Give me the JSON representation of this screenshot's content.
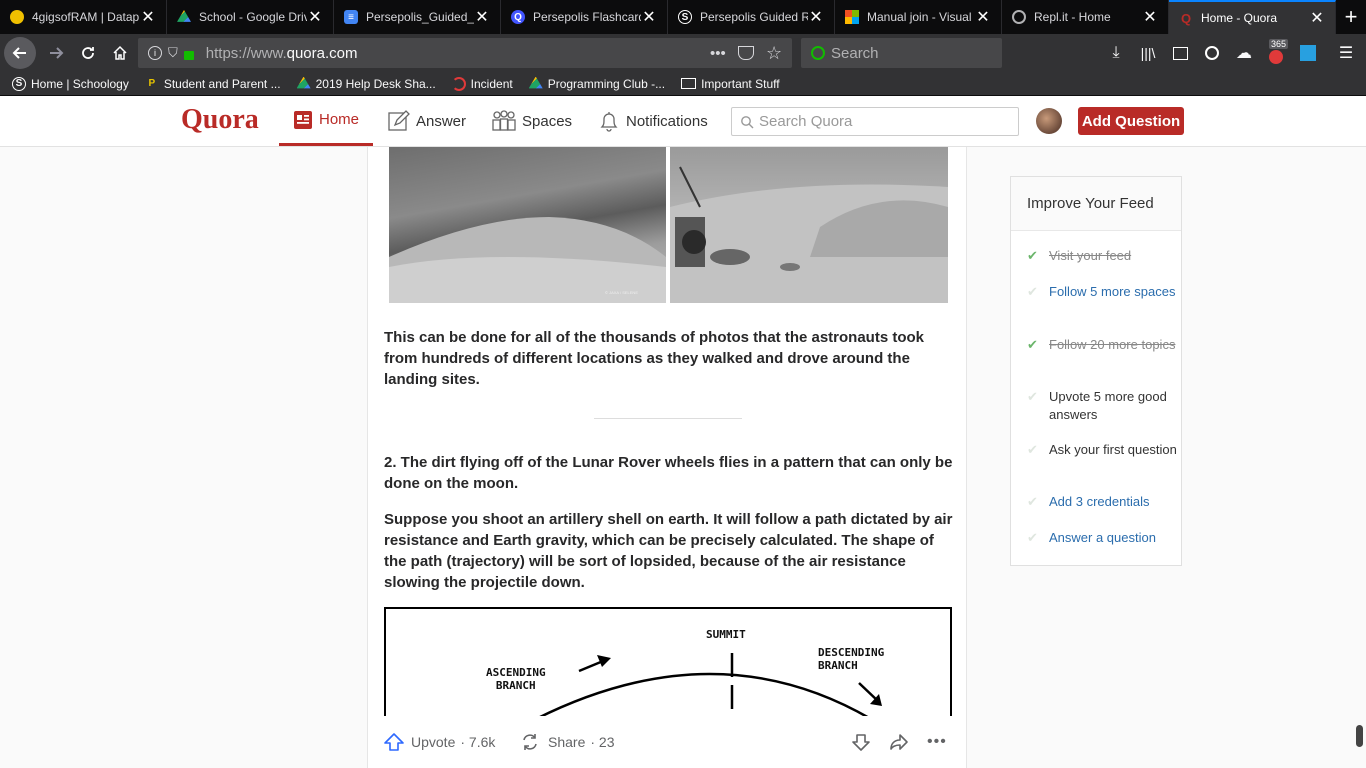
{
  "browser": {
    "tabs": [
      {
        "title": "4gigsofRAM | Datap",
        "favicon_color": "#f0c000"
      },
      {
        "title": "School - Google Driv",
        "favicon_color": "#1fa463"
      },
      {
        "title": "Persepolis_Guided_R",
        "favicon_color": "#4285f4"
      },
      {
        "title": "Persepolis Flashcard",
        "favicon_color": "#4255ff"
      },
      {
        "title": "Persepolis Guided R",
        "favicon_color": "#2a2a2e"
      },
      {
        "title": "Manual join - Visual",
        "favicon_color": "#f25022"
      },
      {
        "title": "Repl.it - Home",
        "favicon_color": "#667881"
      },
      {
        "title": "Home - Quora",
        "favicon_color": "#b92b27"
      }
    ],
    "url_prefix": "https://www.",
    "url_domain": "quora.com",
    "search_placeholder": "Search",
    "badge_count": "365",
    "bookmarks": [
      {
        "label": "Home | Schoology"
      },
      {
        "label": "Student and Parent ..."
      },
      {
        "label": "2019 Help Desk Sha..."
      },
      {
        "label": "Incident"
      },
      {
        "label": "Programming Club -..."
      },
      {
        "label": "Important Stuff"
      }
    ]
  },
  "quora": {
    "logo": "Quora",
    "nav": {
      "home": "Home",
      "answer": "Answer",
      "spaces": "Spaces",
      "notifications": "Notifications"
    },
    "search_placeholder": "Search Quora",
    "add_question": "Add Question"
  },
  "answer": {
    "para1": "This can be done for all of the thousands of photos that the astronauts took from hundreds of different locations as they walked and drove around the landing sites.",
    "heading2": "2. The dirt flying off of the Lunar Rover wheels flies in a pattern that can only be done on the moon.",
    "para2": "Suppose you shoot an artillery shell on earth. It will follow a path dictated by air resistance and Earth gravity, which can be precisely calculated. The shape of the path (trajectory) will be sort of lopsided, because of the air resistance slowing the projectile down.",
    "diagram": {
      "summit": "SUMMIT",
      "ascending": "ASCENDING\nBRANCH",
      "descending": "DESCENDING\nBRANCH"
    },
    "photo_credit": "© JAXA / SELENE",
    "actions": {
      "upvote": "Upvote",
      "upvote_count": "· 7.6k",
      "share": "Share",
      "share_count": "· 23"
    }
  },
  "feed": {
    "title": "Improve Your Feed",
    "items": [
      {
        "label": "Visit your feed",
        "state": "done"
      },
      {
        "label": "Follow 5 more spaces",
        "state": "link"
      },
      {
        "label": "Follow 20 more topics",
        "state": "done"
      },
      {
        "label": "Upvote 5 more good answers",
        "state": "plain"
      },
      {
        "label": "Ask your first question",
        "state": "plain"
      },
      {
        "label": "Add 3 credentials",
        "state": "link"
      },
      {
        "label": "Answer a question",
        "state": "link"
      }
    ]
  }
}
